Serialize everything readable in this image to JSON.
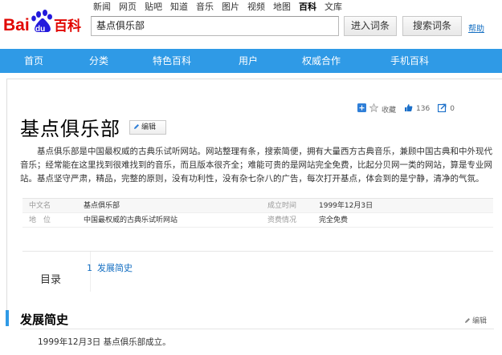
{
  "header": {
    "logo_text": "Bai百科",
    "logo_badge": "du",
    "topnav": [
      "新闻",
      "网页",
      "贴吧",
      "知道",
      "音乐",
      "图片",
      "视频",
      "地图",
      "百科",
      "文库"
    ],
    "active_topnav": "百科",
    "search_value": "基点俱乐部",
    "enter_label": "进入词条",
    "search_label": "搜索词条",
    "help_label": "帮助"
  },
  "mainnav": [
    "首页",
    "分类",
    "特色百科",
    "用户",
    "权威合作",
    "手机百科"
  ],
  "tools": {
    "collect_label": "收藏",
    "like_count": "136",
    "share_count": "0"
  },
  "entry": {
    "title": "基点俱乐部",
    "edit_label": "编辑",
    "summary": "基点俱乐部是中国最权威的古典乐试听网站。网站整理有条，搜索简便，拥有大量西方古典音乐，兼顾中国古典和中外现代音乐；经常能在这里找到很难找到的音乐，而且版本很齐全；难能可贵的是网站完全免费，比起分贝网一类的网站，算是专业网站。基点坚守严肃，精品，完整的原则，没有功利性，没有杂七杂八的广告，每次打开基点，体会到的是宁静，清净的气氛。"
  },
  "infobox": [
    {
      "k1": "中文名",
      "v1": "基点俱乐部",
      "k2": "成立时间",
      "v2": "1999年12月3日"
    },
    {
      "k1": "地　位",
      "v1": "中国最权威的古典乐试听网站",
      "k2": "资费情况",
      "v2": "完全免费"
    }
  ],
  "toc": {
    "title": "目录",
    "items": [
      {
        "num": "1",
        "label": "发展简史"
      }
    ]
  },
  "section": {
    "title": "发展简史",
    "edit_label": "编辑",
    "text": "1999年12月3日 基点俱乐部成立。"
  }
}
